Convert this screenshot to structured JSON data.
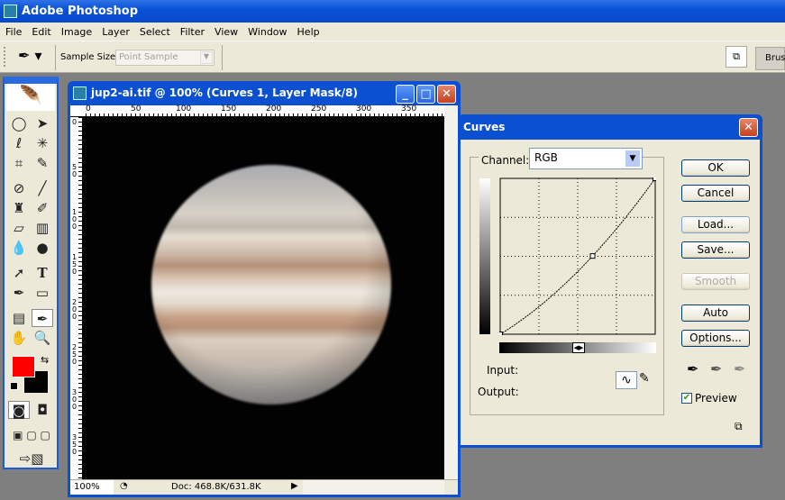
{
  "app": {
    "title": "Adobe Photoshop"
  },
  "menu": [
    "File",
    "Edit",
    "Image",
    "Layer",
    "Select",
    "Filter",
    "View",
    "Window",
    "Help"
  ],
  "options": {
    "sample_size_label": "Sample Size:",
    "sample_size_value": "Point Sample",
    "palette_tab": "Brus"
  },
  "document": {
    "title": "jup2-ai.tif @ 100% (Curves 1, Layer Mask/8)",
    "ruler_top": [
      "0",
      "50",
      "100",
      "150",
      "200",
      "250",
      "300",
      "350"
    ],
    "ruler_left": [
      "0",
      "50",
      "100",
      "150",
      "200",
      "250",
      "300",
      "350"
    ],
    "zoom": "100%",
    "doc_size": "Doc: 468.8K/631.8K"
  },
  "curves": {
    "title": "Curves",
    "channel_label": "Channel:",
    "channel_value": "RGB",
    "input_label": "Input:",
    "output_label": "Output:",
    "buttons": {
      "ok": "OK",
      "cancel": "Cancel",
      "load": "Load...",
      "save": "Save...",
      "smooth": "Smooth",
      "auto": "Auto",
      "options": "Options..."
    },
    "preview_label": "Preview",
    "preview_checked": true,
    "curve_points": [
      [
        0,
        0
      ],
      [
        152,
        128
      ],
      [
        255,
        255
      ]
    ]
  },
  "colors": {
    "foreground": "#ff0000",
    "background": "#000000",
    "titlebar": "#0a50d0"
  }
}
